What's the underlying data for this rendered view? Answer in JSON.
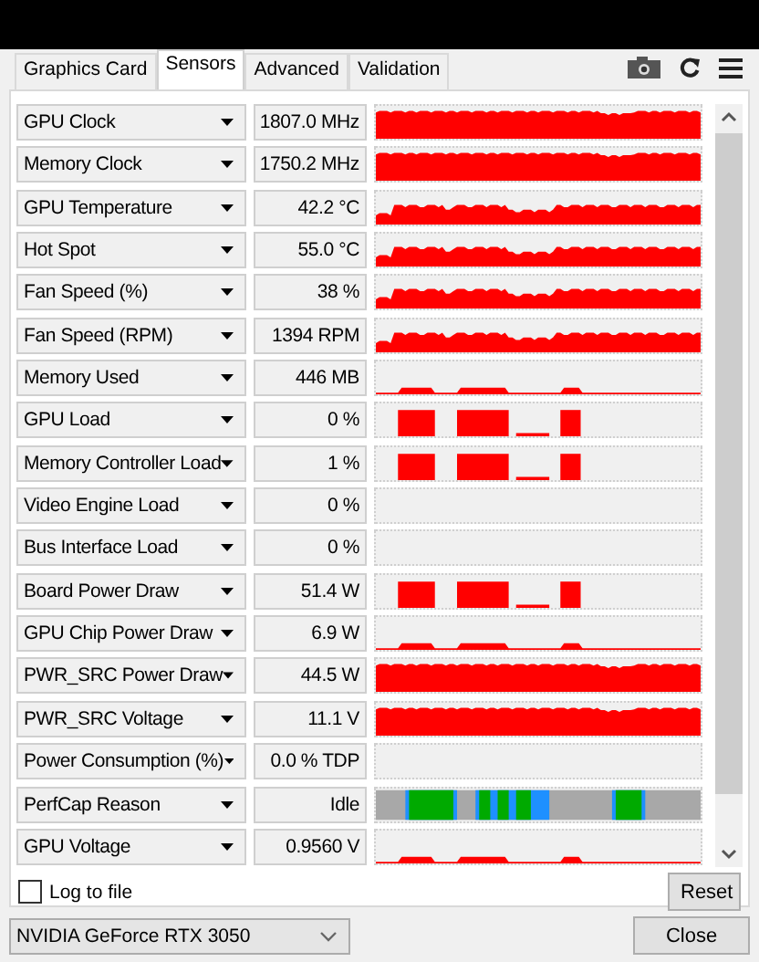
{
  "tabs": [
    {
      "label": "Graphics Card",
      "selected": false
    },
    {
      "label": "Sensors",
      "selected": true
    },
    {
      "label": "Advanced",
      "selected": false
    },
    {
      "label": "Validation",
      "selected": false
    }
  ],
  "sensors": [
    {
      "name": "GPU Clock",
      "value": "1807.0 MHz",
      "kind": "full"
    },
    {
      "name": "Memory Clock",
      "value": "1750.2 MHz",
      "kind": "full"
    },
    {
      "name": "GPU Temperature",
      "value": "42.2 °C",
      "kind": "wave"
    },
    {
      "name": "Hot Spot",
      "value": "55.0 °C",
      "kind": "wave"
    },
    {
      "name": "Fan Speed (%)",
      "value": "38 %",
      "kind": "wave"
    },
    {
      "name": "Fan Speed (RPM)",
      "value": "1394 RPM",
      "kind": "wave"
    },
    {
      "name": "Memory Used",
      "value": "446 MB",
      "kind": "low"
    },
    {
      "name": "GPU Load",
      "value": "0 %",
      "kind": "bursts"
    },
    {
      "name": "Memory Controller Load",
      "value": "1 %",
      "kind": "bursts"
    },
    {
      "name": "Video Engine Load",
      "value": "0 %",
      "kind": "empty"
    },
    {
      "name": "Bus Interface Load",
      "value": "0 %",
      "kind": "empty"
    },
    {
      "name": "Board Power Draw",
      "value": "51.4 W",
      "kind": "bursts"
    },
    {
      "name": "GPU Chip Power Draw",
      "value": "6.9 W",
      "kind": "low"
    },
    {
      "name": "PWR_SRC Power Draw",
      "value": "44.5 W",
      "kind": "full"
    },
    {
      "name": "PWR_SRC Voltage",
      "value": "11.1 V",
      "kind": "full"
    },
    {
      "name": "Power Consumption (%)",
      "value": "0.0 % TDP",
      "kind": "empty"
    },
    {
      "name": "PerfCap Reason",
      "value": "Idle",
      "kind": "perfcap"
    },
    {
      "name": "GPU Voltage",
      "value": "0.9560 V",
      "kind": "low"
    }
  ],
  "log_to_file": {
    "label": "Log to file",
    "checked": false
  },
  "reset_button": "Reset",
  "gpu_select": {
    "value": "NVIDIA GeForce RTX 3050"
  },
  "close_button": "Close"
}
